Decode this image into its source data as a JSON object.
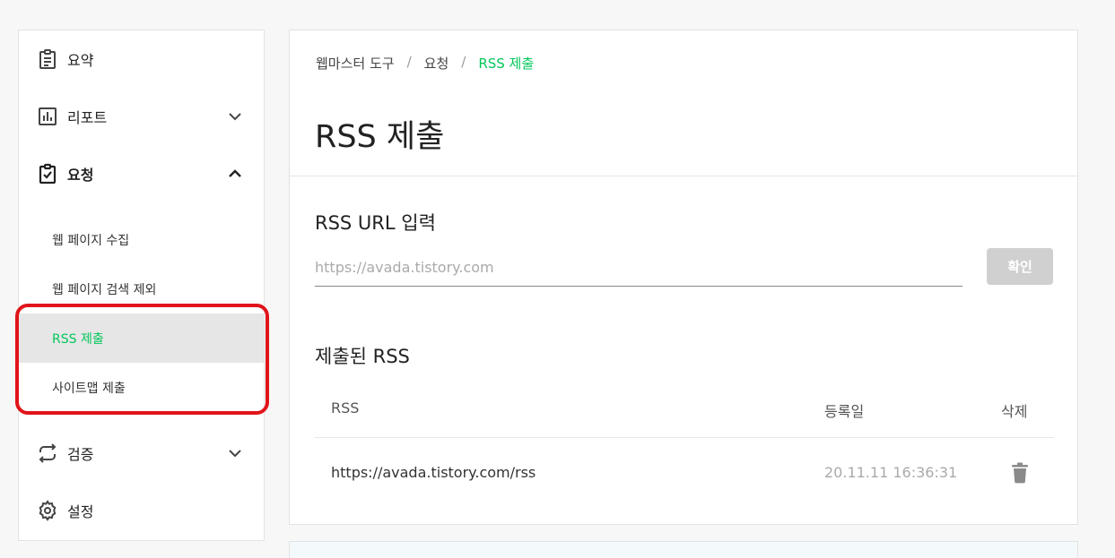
{
  "sidebar": {
    "items": [
      {
        "label": "요약",
        "icon": "clipboard-icon"
      },
      {
        "label": "리포트",
        "icon": "chart-icon"
      },
      {
        "label": "요청",
        "icon": "clipboard-check-icon"
      },
      {
        "label": "검증",
        "icon": "repeat-icon"
      },
      {
        "label": "설정",
        "icon": "gear-icon"
      }
    ],
    "sub_items": [
      {
        "label": "웹 페이지 수집"
      },
      {
        "label": "웹 페이지 검색 제외"
      },
      {
        "label": "RSS 제출",
        "active": true
      },
      {
        "label": "사이트맵 제출"
      }
    ]
  },
  "breadcrumb": {
    "items": [
      "웹마스터 도구",
      "요청",
      "RSS 제출"
    ]
  },
  "main": {
    "title": "RSS 제출",
    "input_section_title": "RSS URL 입력",
    "input_placeholder": "https://avada.tistory.com",
    "confirm_label": "확인",
    "submitted_title": "제출된 RSS",
    "table": {
      "headers": [
        "RSS",
        "등록일",
        "삭제"
      ],
      "rows": [
        {
          "rss": "https://avada.tistory.com/rss",
          "date": "20.11.11 16:36:31"
        }
      ]
    }
  },
  "colors": {
    "accent": "#03c75a",
    "highlight": "#e0141a",
    "button_disabled": "#d0d0d0"
  }
}
